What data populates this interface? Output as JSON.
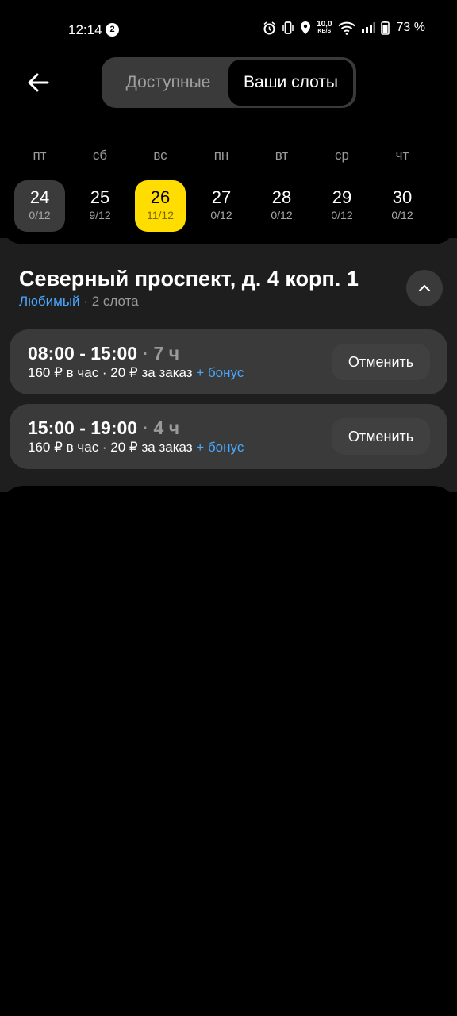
{
  "status_bar": {
    "time": "12:14",
    "notification_count": "2",
    "net_speed_top": "10,0",
    "net_speed_bottom": "KB/S",
    "battery": "73 %"
  },
  "header": {
    "tabs": [
      {
        "label": "Доступные",
        "active": false
      },
      {
        "label": "Ваши слоты",
        "active": true
      }
    ]
  },
  "calendar": {
    "weekdays": [
      "пт",
      "сб",
      "вс",
      "пн",
      "вт",
      "ср",
      "чт"
    ],
    "days": [
      {
        "num": "24",
        "count": "0/12",
        "state": "today"
      },
      {
        "num": "25",
        "count": "9/12",
        "state": ""
      },
      {
        "num": "26",
        "count": "11/12",
        "state": "selected"
      },
      {
        "num": "27",
        "count": "0/12",
        "state": ""
      },
      {
        "num": "28",
        "count": "0/12",
        "state": ""
      },
      {
        "num": "29",
        "count": "0/12",
        "state": ""
      },
      {
        "num": "30",
        "count": "0/12",
        "state": ""
      }
    ]
  },
  "location": {
    "title": "Северный проспект, д. 4 корп. 1",
    "favorite": "Любимый",
    "separator": "·",
    "slot_count": "2 слота"
  },
  "slots": [
    {
      "time": "08:00 - 15:00",
      "duration": "· 7 ч",
      "pay": "160 ₽ в час · 20 ₽ за заказ",
      "bonus": "+ бонус",
      "action": "Отменить"
    },
    {
      "time": "15:00 - 19:00",
      "duration": "· 4 ч",
      "pay": "160 ₽ в час · 20 ₽ за заказ",
      "bonus": "+ бонус",
      "action": "Отменить"
    }
  ],
  "colors": {
    "accent_yellow": "#ffdd00",
    "link_blue": "#4aa8ff",
    "card_bg": "#1e1e1e",
    "slot_bg": "#3a3a3a"
  }
}
